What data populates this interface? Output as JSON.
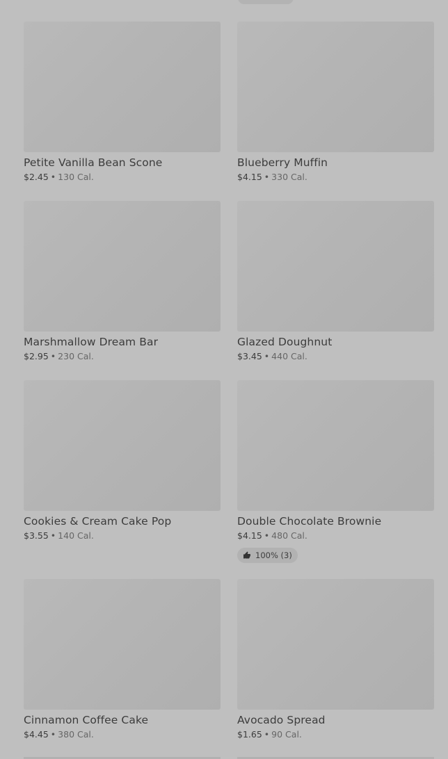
{
  "products": [
    {
      "name": "Petite Vanilla Bean Scone",
      "price": "$2.45",
      "separator": "•",
      "calories": "130 Cal."
    },
    {
      "name": "Blueberry Muffin",
      "price": "$4.15",
      "separator": "•",
      "calories": "330 Cal."
    },
    {
      "name": "Marshmallow Dream Bar",
      "price": "$2.95",
      "separator": "•",
      "calories": "230 Cal."
    },
    {
      "name": "Glazed Doughnut",
      "price": "$3.45",
      "separator": "•",
      "calories": "440 Cal."
    },
    {
      "name": "Cookies & Cream Cake Pop",
      "price": "$3.55",
      "separator": "•",
      "calories": "140 Cal."
    },
    {
      "name": "Double Chocolate Brownie",
      "price": "$4.15",
      "separator": "•",
      "calories": "480 Cal.",
      "rating": "100% (3)"
    },
    {
      "name": "Cinnamon Coffee Cake",
      "price": "$4.45",
      "separator": "•",
      "calories": "380 Cal."
    },
    {
      "name": "Avocado Spread",
      "price": "$1.65",
      "separator": "•",
      "calories": "90 Cal."
    }
  ],
  "icons": {
    "rating_icon": "thumbs-up-icon"
  }
}
